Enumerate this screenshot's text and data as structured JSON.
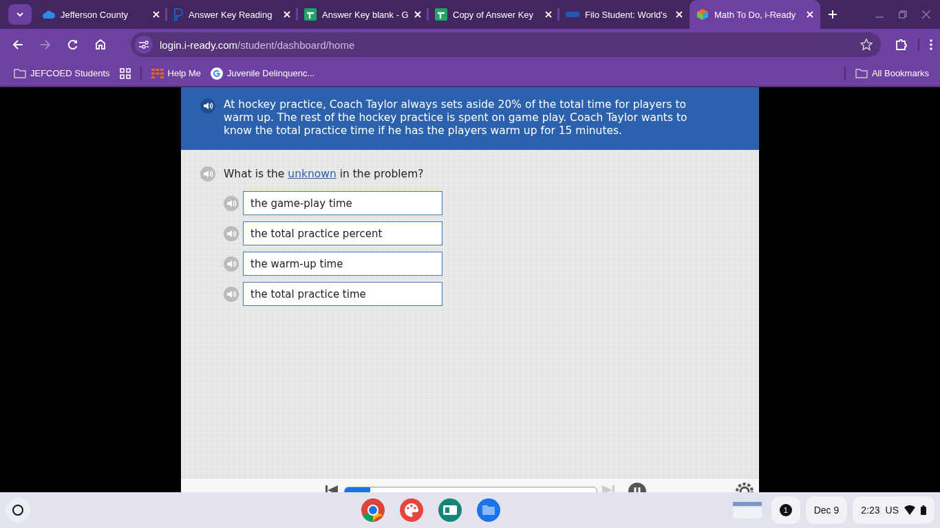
{
  "tabs": [
    {
      "title": "Jefferson County",
      "kind": "cloud",
      "selected": false
    },
    {
      "title": "Answer Key Reading",
      "kind": "p",
      "selected": false
    },
    {
      "title": "Answer Key blank - G",
      "kind": "sheet",
      "selected": false
    },
    {
      "title": "Copy of Answer Key",
      "kind": "sheet",
      "selected": false
    },
    {
      "title": "Filo Student: World's",
      "kind": "filo",
      "selected": false
    },
    {
      "title": "Math To Do, i-Ready",
      "kind": "cube",
      "selected": true
    }
  ],
  "address": {
    "domain": "login.i-ready.com",
    "path": "/student/dashboard/home"
  },
  "bookmarks": [
    {
      "label": "JEFCOED Students",
      "kind": "folder"
    },
    {
      "kind": "apps"
    },
    {
      "label": "Help Me",
      "kind": "grid"
    },
    {
      "label": "Juvenile Delinquenc...",
      "kind": "google"
    }
  ],
  "all_bookmarks": "All Bookmarks",
  "problem": "At hockey practice, Coach Taylor always sets aside 20% of the total time for players to warm up. The rest of the hockey practice is spent on game play. Coach Taylor wants to know the total practice time if he has the players warm up for 15 minutes.",
  "question": {
    "before": "What is the ",
    "link": "unknown",
    "after": " in the problem?"
  },
  "choices": [
    {
      "label": "the game-play time",
      "selected": false
    },
    {
      "label": "the total practice percent",
      "selected": false
    },
    {
      "label": "the warm-up time",
      "selected": false
    },
    {
      "label": "the total practice time",
      "selected": false
    }
  ],
  "player": {
    "level": 0.1
  },
  "shelf": {
    "notifications": "1",
    "date": "Dec 9",
    "time": "2:23",
    "ime": "US"
  }
}
